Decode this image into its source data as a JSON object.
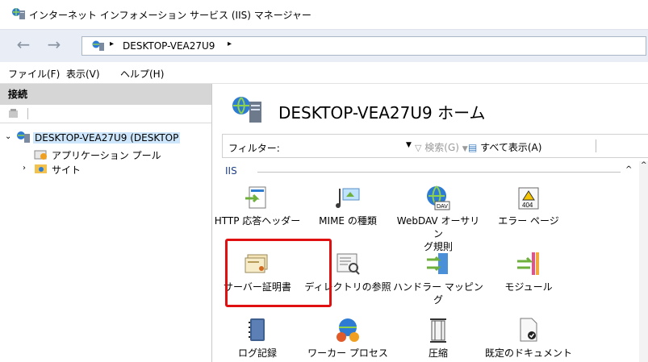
{
  "window": {
    "title": "インターネット インフォメーション サービス (IIS) マネージャー"
  },
  "nav": {
    "back": "←",
    "forward": "→",
    "path": "DESKTOP-VEA27U9",
    "sep": "▸"
  },
  "menu": {
    "file": "ファイル(F)",
    "view": "表示(V)",
    "help": "ヘルプ(H)"
  },
  "sidebar": {
    "header": "接続",
    "tree": [
      {
        "label": "DESKTOP-VEA27U9 (DESKTOP"
      },
      {
        "label": "アプリケーション プール"
      },
      {
        "label": "サイト"
      }
    ]
  },
  "main": {
    "title": "DESKTOP-VEA27U9 ホーム",
    "filter": {
      "label": "フィルター:",
      "go": "検索(G)",
      "showall": "すべて表示(A)"
    },
    "group": "IIS",
    "features": [
      {
        "label": "HTTP 応答ヘッダー",
        "icon": "http-headers-icon"
      },
      {
        "label": "MIME の種類",
        "icon": "mime-icon"
      },
      {
        "label": "WebDAV オーサリン\nグ規則",
        "icon": "webdav-icon"
      },
      {
        "label": "エラー ページ",
        "icon": "error-404-icon"
      },
      {
        "label": "サーバー証明書",
        "icon": "certificate-icon"
      },
      {
        "label": "ディレクトリの参照",
        "icon": "directory-browse-icon"
      },
      {
        "label": "ハンドラー マッピング",
        "icon": "handler-icon"
      },
      {
        "label": "モジュール",
        "icon": "module-icon"
      },
      {
        "label": "ログ記録",
        "icon": "logging-icon"
      },
      {
        "label": "ワーカー プロセス",
        "icon": "worker-icon"
      },
      {
        "label": "圧縮",
        "icon": "compression-icon"
      },
      {
        "label": "既定のドキュメント",
        "icon": "default-document-icon"
      }
    ],
    "badge_404": "404",
    "badge_dav": "DAV"
  },
  "colors": {
    "highlight": "#e01010",
    "accent": "#1e3f8a"
  }
}
